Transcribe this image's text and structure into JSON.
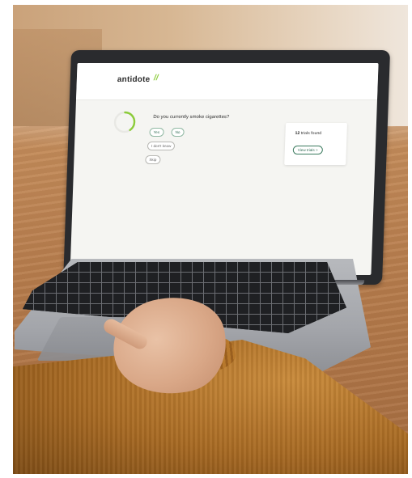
{
  "app": {
    "logo_text": "antidote",
    "logo_mark": "//"
  },
  "question": {
    "text": "Do you currently smoke cigarettes?",
    "progress_fraction": 0.4,
    "answers": [
      {
        "label": "Yes"
      },
      {
        "label": "No"
      }
    ],
    "secondary": [
      {
        "label": "I don't know"
      },
      {
        "label": "Skip"
      }
    ]
  },
  "trials": {
    "count": "12",
    "suffix": " trials found",
    "view_label": "View trials >"
  },
  "colors": {
    "accent_green": "#8ccc3a",
    "button_green": "#2d6a52",
    "ring_track": "#e8e8e4"
  }
}
